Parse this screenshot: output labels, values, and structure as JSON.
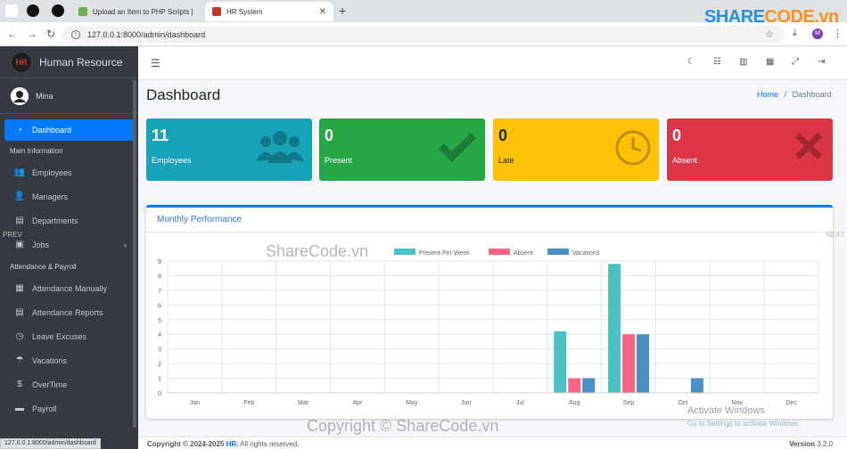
{
  "browser": {
    "tabs": [
      {
        "label": "Upload an Item to PHP Scripts |",
        "active": false
      },
      {
        "label": "HR System",
        "active": true
      }
    ],
    "url": "127.0.0.1:8000/admin/dashboard",
    "status_url": "127.0.0.1:8000/admin/dashboard",
    "profile_initial": "M"
  },
  "watermark": {
    "logo_a": "SHARE",
    "logo_b": "CODE.vn",
    "center": "ShareCode.vn",
    "copyright": "Copyright © ShareCode.vn",
    "prev": "PREV",
    "next": "NEXT"
  },
  "sidebar": {
    "brand_logo": "HR",
    "brand_name": "Human Resource",
    "user_name": "Mina",
    "items": [
      {
        "type": "item",
        "label": "Dashboard",
        "icon": "dashboard-icon",
        "active": true
      },
      {
        "type": "header",
        "label": "Main Information"
      },
      {
        "type": "item",
        "label": "Employees",
        "icon": "users-icon"
      },
      {
        "type": "item",
        "label": "Managers",
        "icon": "user-icon"
      },
      {
        "type": "item",
        "label": "Departments",
        "icon": "building-icon"
      },
      {
        "type": "item",
        "label": "Jobs",
        "icon": "briefcase-icon",
        "arrow": true
      },
      {
        "type": "header",
        "label": "Attendance & Payroll"
      },
      {
        "type": "item",
        "label": "Attendance Manually",
        "icon": "calendar-icon"
      },
      {
        "type": "item",
        "label": "Attendance Reports",
        "icon": "file-icon"
      },
      {
        "type": "item",
        "label": "Leave Excuses",
        "icon": "clock-icon"
      },
      {
        "type": "item",
        "label": "Vacations",
        "icon": "umbrella-icon"
      },
      {
        "type": "item",
        "label": "OverTime",
        "icon": "dollar-icon"
      },
      {
        "type": "item",
        "label": "Payroll",
        "icon": "money-icon"
      }
    ]
  },
  "header": {
    "page_title": "Dashboard",
    "breadcrumb_home": "Home",
    "breadcrumb_sep": "/",
    "breadcrumb_current": "Dashboard"
  },
  "stats": [
    {
      "value": "11",
      "label": "Employees",
      "color": "#17a2b8",
      "icon": "users-icon"
    },
    {
      "value": "0",
      "label": "Present",
      "color": "#28a745",
      "icon": "check-icon"
    },
    {
      "value": "0",
      "label": "Late",
      "color": "#ffc107",
      "icon": "clock-icon"
    },
    {
      "value": "0",
      "label": "Absent",
      "color": "#dc3545",
      "icon": "times-icon"
    }
  ],
  "performance": {
    "title": "Monthly Performance"
  },
  "chart_data": {
    "type": "bar",
    "categories": [
      "Jan",
      "Feb",
      "Mar",
      "Apr",
      "May",
      "Jun",
      "Jul",
      "Aug",
      "Sep",
      "Oct",
      "Nov",
      "Dec"
    ],
    "series": [
      {
        "name": "Present Per Week",
        "color": "#4bc0c0",
        "values": [
          0,
          0,
          0,
          0,
          0,
          0,
          0,
          4.2,
          8.8,
          0,
          0,
          0
        ]
      },
      {
        "name": "Absent",
        "color": "#ff6384",
        "values": [
          0,
          0,
          0,
          0,
          0,
          0,
          0,
          1,
          4,
          0,
          0,
          0
        ]
      },
      {
        "name": "Vacations",
        "color": "#4a90c2",
        "values": [
          0,
          0,
          0,
          0,
          0,
          0,
          0,
          1,
          4,
          1,
          0,
          0
        ]
      }
    ],
    "ylim": [
      0,
      9
    ],
    "yticks": [
      0,
      1,
      2,
      3,
      4,
      5,
      6,
      7,
      8,
      9
    ],
    "legend": "top-center",
    "grid": true
  },
  "footer": {
    "copyright": "Copyright © 2024-2025",
    "brand": "HR.",
    "rights": "All rights reserved.",
    "version_label": "Version",
    "version": "3.2.0"
  },
  "windows": {
    "activate_title": "Activate Windows",
    "activate_sub": "Go to Settings to activate Windows."
  }
}
